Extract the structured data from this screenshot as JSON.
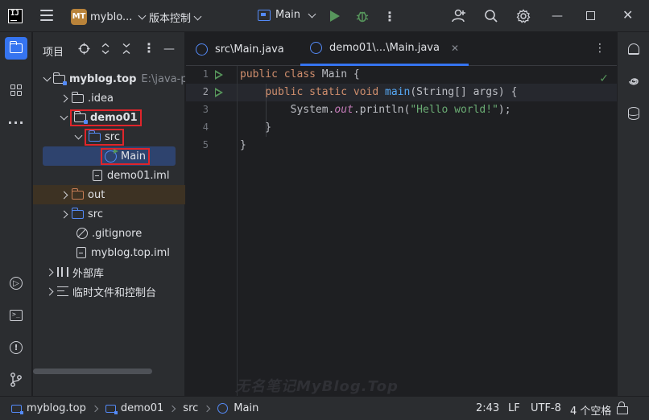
{
  "titlebar": {
    "project_badge": "MT",
    "project_name": "myblo...",
    "vcs_label": "版本控制",
    "run_config": "Main"
  },
  "project_panel": {
    "title": "项目",
    "tree": [
      {
        "label": "myblog.top",
        "path": "E:\\java-pro",
        "expanded": true
      },
      {
        "label": ".idea",
        "expanded": false
      },
      {
        "label": "demo01",
        "expanded": true
      },
      {
        "label": "src",
        "expanded": true
      },
      {
        "label": "Main",
        "selected": true
      },
      {
        "label": "demo01.iml"
      },
      {
        "label": "out",
        "expanded": false
      },
      {
        "label": "src",
        "expanded": false
      },
      {
        "label": ".gitignore"
      },
      {
        "label": "myblog.top.iml"
      },
      {
        "label": "外部库",
        "expanded": false
      },
      {
        "label": "临时文件和控制台",
        "expanded": false
      }
    ]
  },
  "editor": {
    "tabs": [
      {
        "label": "src\\Main.java",
        "active": false
      },
      {
        "label": "demo01\\...\\Main.java",
        "active": true
      }
    ],
    "lines": [
      {
        "number": "1",
        "text": "public class Main {"
      },
      {
        "number": "2",
        "text": "    public static void main(String[] args) {"
      },
      {
        "number": "3",
        "text": "        System.out.println(\"Hello world!\");"
      },
      {
        "number": "4",
        "text": "    }"
      },
      {
        "number": "5",
        "text": "}"
      }
    ]
  },
  "statusbar": {
    "breadcrumbs": [
      "myblog.top",
      "demo01",
      "src",
      "Main"
    ],
    "position": "2:43",
    "line_separator": "LF",
    "encoding": "UTF-8",
    "indent": "4 个空格"
  },
  "watermark": "无名笔记MyBlog.Top",
  "colors": {
    "accent": "#3574f0",
    "keyword": "#cf8e6d",
    "function": "#56a8f5",
    "string": "#6aab73",
    "run_green": "#57965c",
    "highlight_box": "#e0252b"
  }
}
